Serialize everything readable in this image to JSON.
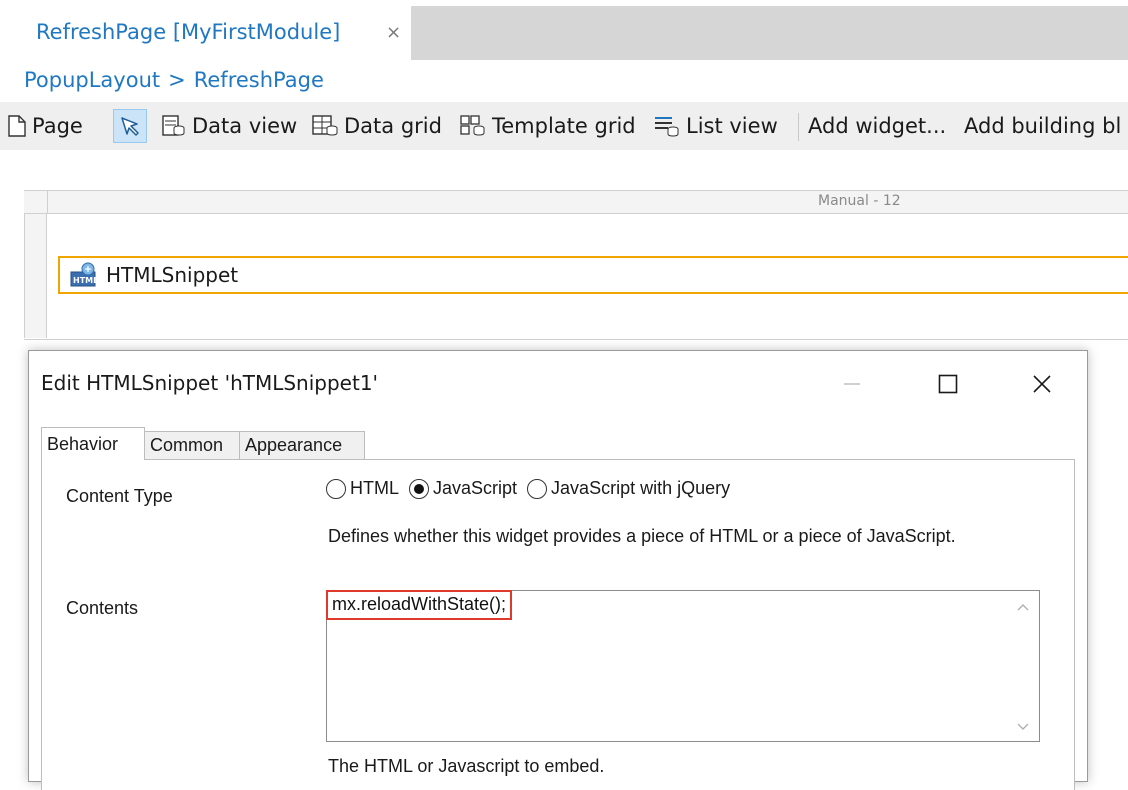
{
  "document_tab": {
    "title": "RefreshPage [MyFirstModule]",
    "close_glyph": "×"
  },
  "breadcrumb": {
    "items": [
      "PopupLayout",
      "RefreshPage"
    ],
    "separator": ">"
  },
  "toolbar": {
    "page": "Page",
    "data_view": "Data view",
    "data_grid": "Data grid",
    "template_grid": "Template grid",
    "list_view": "List view",
    "add_widget": "Add widget...",
    "add_building_blocks": "Add building bl"
  },
  "layout_grid": {
    "ruler_label": "Manual - 12"
  },
  "widget": {
    "label": "HTMLSnippet",
    "icon": "html-snippet-icon"
  },
  "dialog": {
    "title": "Edit HTMLSnippet 'hTMLSnippet1'",
    "tabs": [
      "Behavior",
      "Common",
      "Appearance"
    ],
    "content_type": {
      "label": "Content Type",
      "options": [
        "HTML",
        "JavaScript",
        "JavaScript with jQuery"
      ],
      "selected": "JavaScript",
      "description": "Defines whether this widget provides a piece of HTML or a piece of JavaScript."
    },
    "contents": {
      "label": "Contents",
      "value": "mx.reloadWithState();",
      "description": "The HTML or Javascript to embed."
    }
  },
  "colors": {
    "link": "#1f78c1",
    "selection_border": "#f0a500",
    "highlight": "#e0392b"
  }
}
